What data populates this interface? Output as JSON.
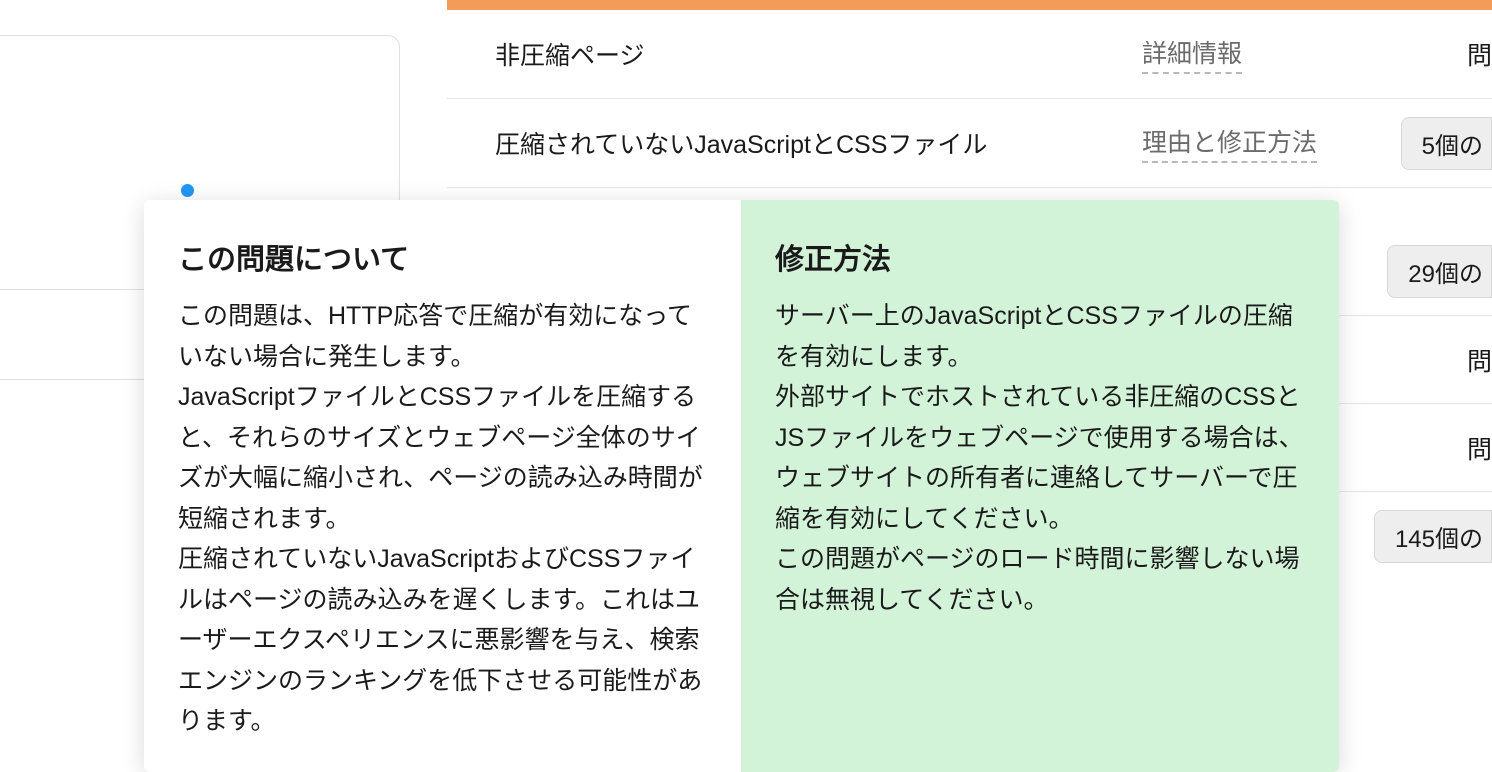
{
  "rows": [
    {
      "title": "非圧縮ページ",
      "link_label": "詳細情報",
      "right_label": "問"
    },
    {
      "title": "圧縮されていないJavaScriptとCSSファイル",
      "link_label": "理由と修正方法",
      "count_label": "5個の"
    }
  ],
  "extra_rows": [
    {
      "count_label": "29個の"
    },
    {
      "right_label": "問"
    },
    {
      "right_label": "問"
    },
    {
      "count_label": "145個の"
    }
  ],
  "tooltip": {
    "left": {
      "heading": "この問題について",
      "body": "この問題は、HTTP応答で圧縮が有効になっていない場合に発生します。\nJavaScriptファイルとCSSファイルを圧縮すると、それらのサイズとウェブページ全体のサイズが大幅に縮小され、ページの読み込み時間が短縮されます。\n圧縮されていないJavaScriptおよびCSSファイルはページの読み込みを遅くします。これはユーザーエクスペリエンスに悪影響を与え、検索エンジンのランキングを低下させる可能性があります。"
    },
    "right": {
      "heading": "修正方法",
      "body": "サーバー上のJavaScriptとCSSファイルの圧縮を有効にします。\n外部サイトでホストされている非圧縮のCSSとJSファイルをウェブページで使用する場合は、ウェブサイトの所有者に連絡してサーバーで圧縮を有効にしてください。\nこの問題がページのロード時間に影響しない場合は無視してください。"
    }
  }
}
